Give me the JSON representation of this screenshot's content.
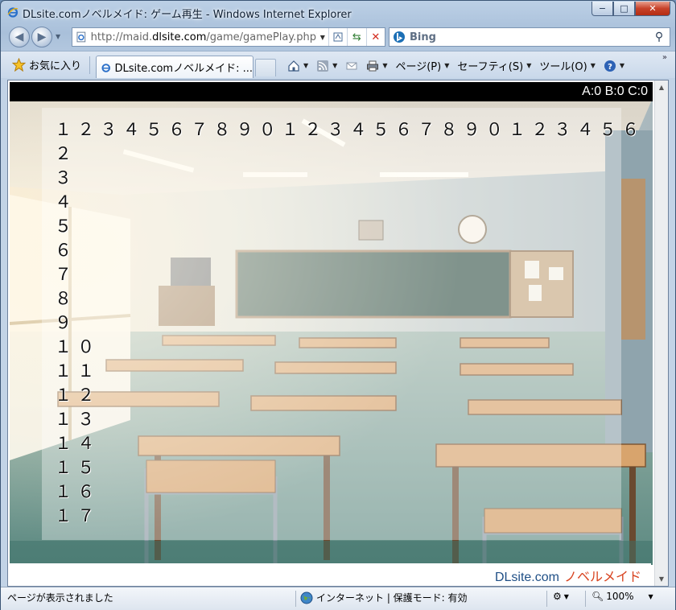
{
  "window": {
    "title": "DLsite.comノベルメイド: ゲーム再生 - Windows Internet Explorer",
    "min_label": "−",
    "max_label": "□",
    "close_label": "✕"
  },
  "address": {
    "url_prefix": "http://maid.",
    "url_domain": "dlsite.com",
    "url_suffix": "/game/gamePlay.php?i"
  },
  "search": {
    "engine": "Bing"
  },
  "favorites": {
    "label": "お気に入り"
  },
  "tab": {
    "label": "DLsite.comノベルメイド: ..."
  },
  "commands": {
    "page": "ページ(P)",
    "safety": "セーフティ(S)",
    "tools": "ツール(O)"
  },
  "game": {
    "score": "A:0 B:0 C:0",
    "top_row": "１２３４５６７８９０１２３４５６７８９０１２３４５６",
    "rows": [
      "２",
      "３",
      "４",
      "５",
      "６",
      "７",
      "８",
      "９",
      "１０",
      "１１",
      "１２",
      "１３",
      "１４",
      "１５",
      "１６",
      "１７"
    ],
    "brand_main": "DLsite.com",
    "brand_sub": "ノベルメイド"
  },
  "status": {
    "text": "ページが表示されました",
    "zone": "インターネット | 保護モード: 有効",
    "zoom": "100%"
  }
}
